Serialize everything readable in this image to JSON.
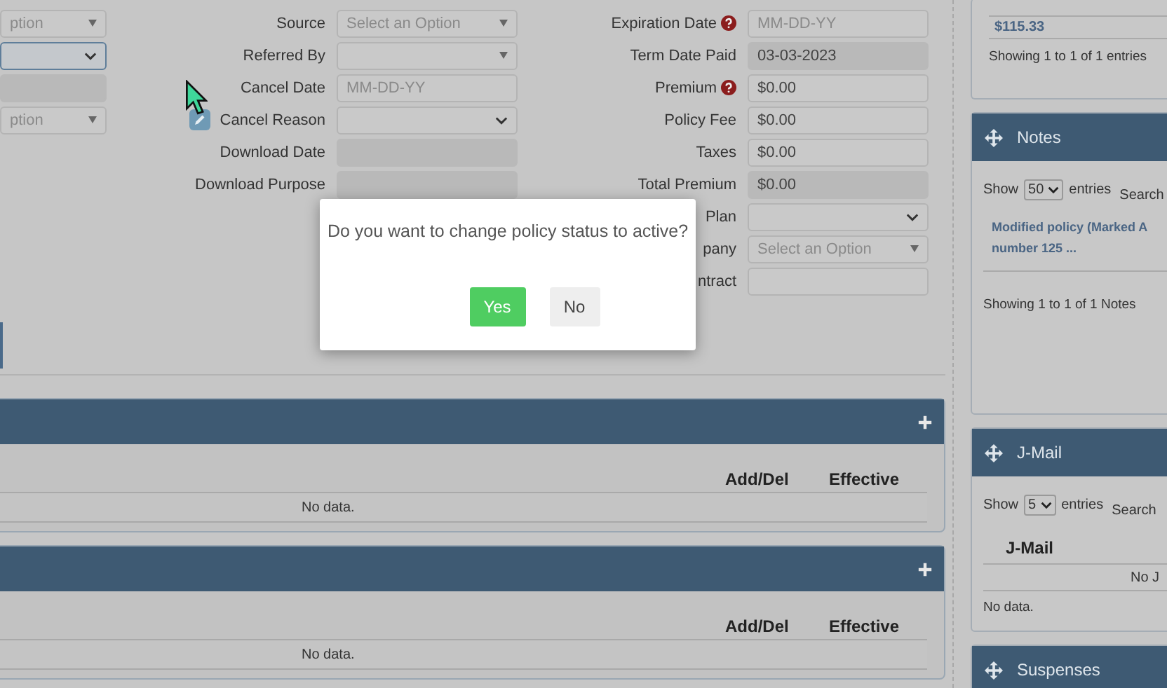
{
  "left_fields": [
    {
      "kind": "select",
      "placeholder": "ption"
    },
    {
      "kind": "native_select",
      "focused": true
    },
    {
      "kind": "disabled"
    },
    {
      "kind": "select",
      "placeholder": "ption"
    }
  ],
  "middle_fields": [
    {
      "label": "Source",
      "kind": "select",
      "placeholder": "Select an Option"
    },
    {
      "label": "Referred By",
      "kind": "select"
    },
    {
      "label": "Cancel Date",
      "kind": "text",
      "placeholder": "MM-DD-YY"
    },
    {
      "label": "Cancel Reason",
      "kind": "native_select",
      "edit_icon": true
    },
    {
      "label": "Download Date",
      "kind": "disabled"
    },
    {
      "label": "Download Purpose",
      "kind": "disabled"
    }
  ],
  "right_fields": [
    {
      "label": "Expiration Date",
      "help": true,
      "kind": "text",
      "placeholder": "MM-DD-YY"
    },
    {
      "label": "Term Date Paid",
      "kind": "disabled",
      "value": "03-03-2023"
    },
    {
      "label": "Premium",
      "help": true,
      "kind": "text",
      "value": "$0.00"
    },
    {
      "label": "Policy Fee",
      "kind": "text",
      "value": "$0.00"
    },
    {
      "label": "Taxes",
      "kind": "text",
      "value": "$0.00"
    },
    {
      "label": "Total Premium",
      "kind": "disabled",
      "value": "$0.00"
    },
    {
      "label": "Plan",
      "kind": "native_select"
    },
    {
      "label": "pany",
      "kind": "select",
      "placeholder": "Select an Option"
    },
    {
      "label": "ntract",
      "kind": "text"
    }
  ],
  "panels": [
    {
      "columns": [
        "Add/Del",
        "Effective"
      ],
      "empty_text": "No data."
    },
    {
      "columns": [
        "Add/Del",
        "Effective"
      ],
      "empty_text": "No data."
    }
  ],
  "sidebar": {
    "amount_card": {
      "value": "$115.33",
      "info": "Showing 1 to 1 of 1 entries"
    },
    "notes": {
      "title": "Notes",
      "show_label": "Show",
      "page_size": "50",
      "entries_label": "entries",
      "search_label": "Search",
      "note": "Modified policy (Marked A number 125 ...",
      "info": "Showing 1 to 1 of 1 Notes"
    },
    "jmail": {
      "title": "J-Mail",
      "show_label": "Show",
      "page_size": "5",
      "entries_label": "entries",
      "search_label": "Search",
      "column": "J-Mail",
      "row_text": "No J",
      "empty_text": "No data."
    },
    "suspenses": {
      "title": "Suspenses"
    }
  },
  "dialog": {
    "message": "Do you want to change policy status to active?",
    "buttons": [
      {
        "label": "Yes",
        "kind": "primary"
      },
      {
        "label": "No",
        "kind": "secondary"
      }
    ]
  }
}
